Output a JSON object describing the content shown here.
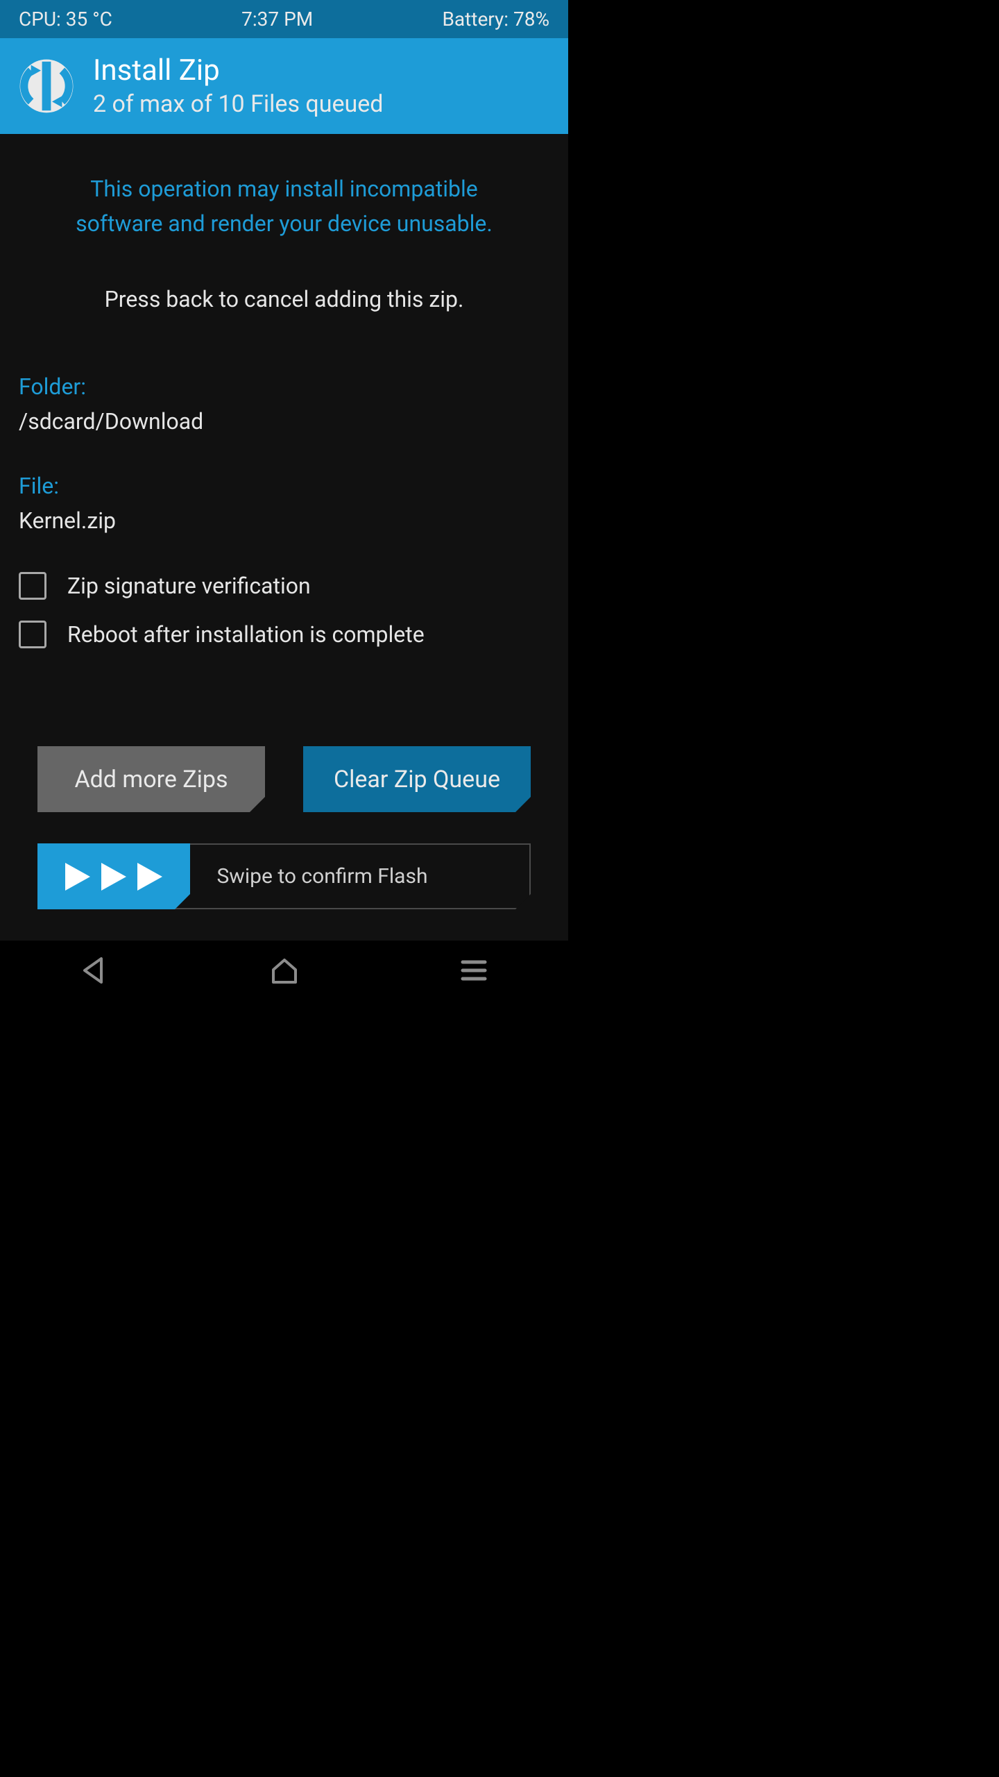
{
  "statusbar": {
    "cpu": "CPU: 35 °C",
    "time": "7:37 PM",
    "battery": "Battery: 78%"
  },
  "header": {
    "title": "Install Zip",
    "subtitle": "2 of max of 10 Files queued"
  },
  "warning": "This operation may install incompatible software and render your device unusable.",
  "instruction": "Press back to cancel adding this zip.",
  "folder": {
    "label": "Folder:",
    "value": "/sdcard/Download"
  },
  "file": {
    "label": "File:",
    "value": "Kernel.zip"
  },
  "checkboxes": {
    "zipSig": "Zip signature verification",
    "reboot": "Reboot after installation is complete"
  },
  "buttons": {
    "addMore": "Add more Zips",
    "clear": "Clear Zip Queue"
  },
  "swipe": {
    "label": "Swipe to confirm Flash"
  }
}
